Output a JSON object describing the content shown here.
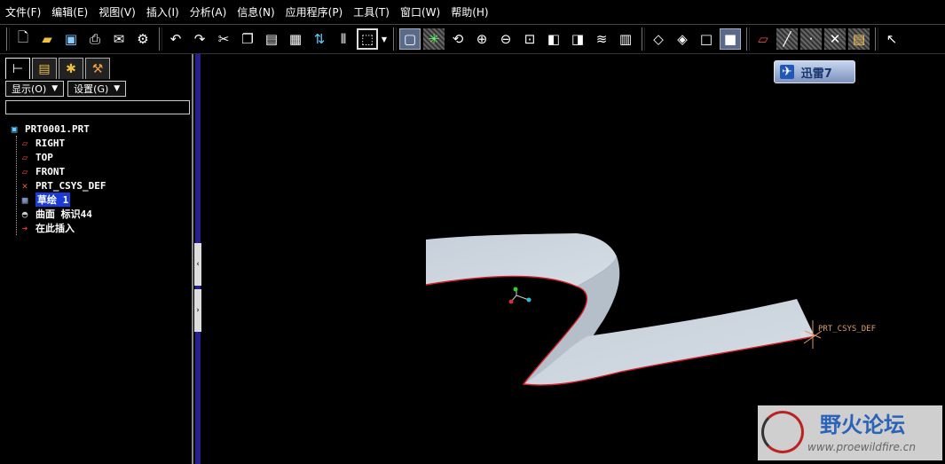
{
  "menu": [
    "文件(F)",
    "编辑(E)",
    "视图(V)",
    "插入(I)",
    "分析(A)",
    "信息(N)",
    "应用程序(P)",
    "工具(T)",
    "窗口(W)",
    "帮助(H)"
  ],
  "toolbar": {
    "icons": [
      "new-icon",
      "open-icon",
      "save-icon",
      "print-icon",
      "send-icon",
      "settings-icon",
      "undo-icon",
      "redo-icon",
      "cut-icon",
      "copy-icon",
      "paste-icon",
      "paste-special-icon",
      "regenerate-icon",
      "mirror-icon",
      "selection-box-icon",
      "repaint-icon",
      "spin-center-icon",
      "orient-icon",
      "zoom-in-icon",
      "zoom-out-icon",
      "refit-icon",
      "named-view-icon",
      "view-manager-icon",
      "layers-icon",
      "model-display-icon",
      "wireframe-icon",
      "hidden-line-icon",
      "no-hidden-icon",
      "shading-icon",
      "datum-plane-icon",
      "datum-axis-icon",
      "datum-point-icon",
      "csys-icon",
      "annotation-icon",
      "select-icon"
    ]
  },
  "left_panel": {
    "tabs": [
      "model-tree-icon",
      "layer-tree-icon",
      "favorites-icon",
      "connections-icon"
    ],
    "show_label": "显示(O)",
    "settings_label": "设置(G)",
    "search_value": "",
    "tree": {
      "root": "PRT0001.PRT",
      "items": [
        {
          "label": "RIGHT",
          "icon": "datum-plane-icon"
        },
        {
          "label": "TOP",
          "icon": "datum-plane-icon"
        },
        {
          "label": "FRONT",
          "icon": "datum-plane-icon"
        },
        {
          "label": "PRT_CSYS_DEF",
          "icon": "csys-icon"
        },
        {
          "label": "草绘 1",
          "icon": "sketch-icon"
        },
        {
          "label": "曲面 标识44",
          "icon": "surface-icon"
        },
        {
          "label": "在此插入",
          "icon": "insert-here-icon"
        }
      ]
    }
  },
  "graphics": {
    "csys_label": "PRT_CSYS_DEF",
    "thunder_label": "迅雷7",
    "watermark_title": "野火论坛",
    "watermark_url": "www.proewildfire.cn"
  },
  "colors": {
    "surface": "#c8d2dc",
    "surface_edge": "#d4202c",
    "selection_highlight": "#1a3bd6",
    "splitter": "#24208c"
  }
}
